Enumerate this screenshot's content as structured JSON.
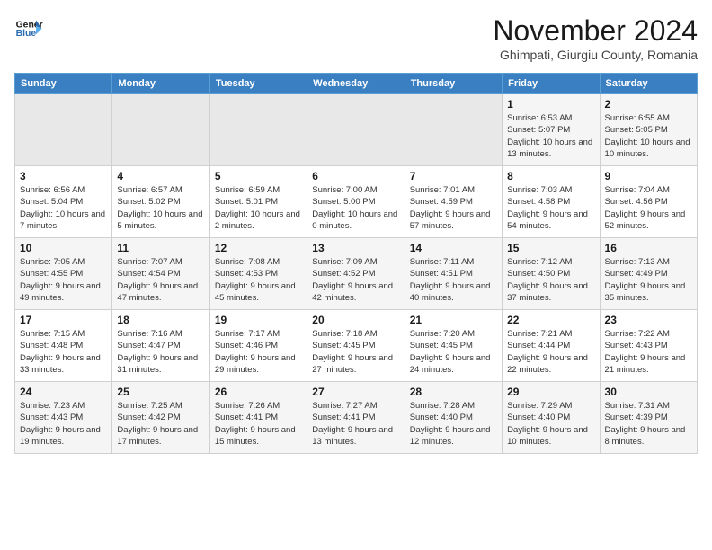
{
  "header": {
    "logo_line1": "General",
    "logo_line2": "Blue",
    "month_year": "November 2024",
    "location": "Ghimpati, Giurgiu County, Romania"
  },
  "weekdays": [
    "Sunday",
    "Monday",
    "Tuesday",
    "Wednesday",
    "Thursday",
    "Friday",
    "Saturday"
  ],
  "weeks": [
    [
      {
        "day": "",
        "info": ""
      },
      {
        "day": "",
        "info": ""
      },
      {
        "day": "",
        "info": ""
      },
      {
        "day": "",
        "info": ""
      },
      {
        "day": "",
        "info": ""
      },
      {
        "day": "1",
        "info": "Sunrise: 6:53 AM\nSunset: 5:07 PM\nDaylight: 10 hours and 13 minutes."
      },
      {
        "day": "2",
        "info": "Sunrise: 6:55 AM\nSunset: 5:05 PM\nDaylight: 10 hours and 10 minutes."
      }
    ],
    [
      {
        "day": "3",
        "info": "Sunrise: 6:56 AM\nSunset: 5:04 PM\nDaylight: 10 hours and 7 minutes."
      },
      {
        "day": "4",
        "info": "Sunrise: 6:57 AM\nSunset: 5:02 PM\nDaylight: 10 hours and 5 minutes."
      },
      {
        "day": "5",
        "info": "Sunrise: 6:59 AM\nSunset: 5:01 PM\nDaylight: 10 hours and 2 minutes."
      },
      {
        "day": "6",
        "info": "Sunrise: 7:00 AM\nSunset: 5:00 PM\nDaylight: 10 hours and 0 minutes."
      },
      {
        "day": "7",
        "info": "Sunrise: 7:01 AM\nSunset: 4:59 PM\nDaylight: 9 hours and 57 minutes."
      },
      {
        "day": "8",
        "info": "Sunrise: 7:03 AM\nSunset: 4:58 PM\nDaylight: 9 hours and 54 minutes."
      },
      {
        "day": "9",
        "info": "Sunrise: 7:04 AM\nSunset: 4:56 PM\nDaylight: 9 hours and 52 minutes."
      }
    ],
    [
      {
        "day": "10",
        "info": "Sunrise: 7:05 AM\nSunset: 4:55 PM\nDaylight: 9 hours and 49 minutes."
      },
      {
        "day": "11",
        "info": "Sunrise: 7:07 AM\nSunset: 4:54 PM\nDaylight: 9 hours and 47 minutes."
      },
      {
        "day": "12",
        "info": "Sunrise: 7:08 AM\nSunset: 4:53 PM\nDaylight: 9 hours and 45 minutes."
      },
      {
        "day": "13",
        "info": "Sunrise: 7:09 AM\nSunset: 4:52 PM\nDaylight: 9 hours and 42 minutes."
      },
      {
        "day": "14",
        "info": "Sunrise: 7:11 AM\nSunset: 4:51 PM\nDaylight: 9 hours and 40 minutes."
      },
      {
        "day": "15",
        "info": "Sunrise: 7:12 AM\nSunset: 4:50 PM\nDaylight: 9 hours and 37 minutes."
      },
      {
        "day": "16",
        "info": "Sunrise: 7:13 AM\nSunset: 4:49 PM\nDaylight: 9 hours and 35 minutes."
      }
    ],
    [
      {
        "day": "17",
        "info": "Sunrise: 7:15 AM\nSunset: 4:48 PM\nDaylight: 9 hours and 33 minutes."
      },
      {
        "day": "18",
        "info": "Sunrise: 7:16 AM\nSunset: 4:47 PM\nDaylight: 9 hours and 31 minutes."
      },
      {
        "day": "19",
        "info": "Sunrise: 7:17 AM\nSunset: 4:46 PM\nDaylight: 9 hours and 29 minutes."
      },
      {
        "day": "20",
        "info": "Sunrise: 7:18 AM\nSunset: 4:45 PM\nDaylight: 9 hours and 27 minutes."
      },
      {
        "day": "21",
        "info": "Sunrise: 7:20 AM\nSunset: 4:45 PM\nDaylight: 9 hours and 24 minutes."
      },
      {
        "day": "22",
        "info": "Sunrise: 7:21 AM\nSunset: 4:44 PM\nDaylight: 9 hours and 22 minutes."
      },
      {
        "day": "23",
        "info": "Sunrise: 7:22 AM\nSunset: 4:43 PM\nDaylight: 9 hours and 21 minutes."
      }
    ],
    [
      {
        "day": "24",
        "info": "Sunrise: 7:23 AM\nSunset: 4:43 PM\nDaylight: 9 hours and 19 minutes."
      },
      {
        "day": "25",
        "info": "Sunrise: 7:25 AM\nSunset: 4:42 PM\nDaylight: 9 hours and 17 minutes."
      },
      {
        "day": "26",
        "info": "Sunrise: 7:26 AM\nSunset: 4:41 PM\nDaylight: 9 hours and 15 minutes."
      },
      {
        "day": "27",
        "info": "Sunrise: 7:27 AM\nSunset: 4:41 PM\nDaylight: 9 hours and 13 minutes."
      },
      {
        "day": "28",
        "info": "Sunrise: 7:28 AM\nSunset: 4:40 PM\nDaylight: 9 hours and 12 minutes."
      },
      {
        "day": "29",
        "info": "Sunrise: 7:29 AM\nSunset: 4:40 PM\nDaylight: 9 hours and 10 minutes."
      },
      {
        "day": "30",
        "info": "Sunrise: 7:31 AM\nSunset: 4:39 PM\nDaylight: 9 hours and 8 minutes."
      }
    ]
  ]
}
